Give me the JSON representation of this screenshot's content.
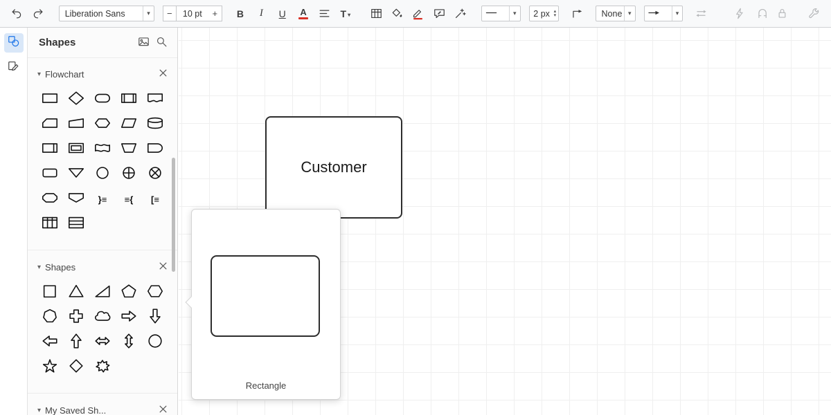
{
  "colors": {
    "accent": "#1a73e8",
    "danger": "#d93025",
    "shape_stroke": "#1a1a1a"
  },
  "toolbar": {
    "icon_undo": "undo-icon",
    "icon_redo": "redo-icon",
    "font_name": "Liberation Sans",
    "size_minus": "−",
    "size_value": "10 pt",
    "size_plus": "+",
    "bold": "B",
    "italic": "I",
    "underline": "U",
    "font_color": "A",
    "icon_align": "align-icon",
    "text_options": "T",
    "icon_table": "table-icon",
    "icon_fill": "fill-color-icon",
    "icon_line_color": "line-color-icon",
    "icon_edit_style": "edit-style-icon",
    "icon_magic_wand": "magic-wand-icon",
    "icon_line_style": "h-line-icon",
    "line_width": "2 px",
    "icon_waypoints": "waypoints-icon",
    "connection": "None",
    "icon_arrow": "arrow-line-icon",
    "icon_swap": "swap-arrows-icon",
    "icon_lightning": "lightning-icon",
    "icon_magnet": "magnet-icon",
    "icon_lock": "lock-icon",
    "icon_wrench": "wrench-icon"
  },
  "rail": {
    "icon_shapes": "shapes-panel-icon",
    "icon_sketch": "sketch-icon"
  },
  "sidebar": {
    "title": "Shapes",
    "icon_image": "image-icon",
    "icon_search": "search-icon",
    "icon_close": "close-icon",
    "sections": [
      {
        "label": "Flowchart",
        "shapes": [
          "process",
          "decision",
          "terminator",
          "predefined-process",
          "document",
          "card",
          "manual-input",
          "preparation",
          "data",
          "database",
          "internal-storage",
          "frame",
          "tape",
          "manual-operation",
          "delay",
          "process-alt",
          "merge",
          "connector",
          "or-junction",
          "summing-junction",
          "loop-limit",
          "off-page-connector",
          "annotation-right",
          "annotation-left",
          "annotation-bracket",
          "column-table",
          "row-table"
        ]
      },
      {
        "label": "Shapes",
        "shapes": [
          "square",
          "triangle",
          "right-triangle",
          "pentagon",
          "hexagon",
          "heptagon",
          "cross",
          "cloud",
          "block-arrow-right",
          "block-arrow-down",
          "block-arrow-left",
          "block-arrow-up",
          "block-arrow-horizontal",
          "block-arrow-vertical",
          "circle",
          "star",
          "diamond",
          "irregular-star"
        ]
      },
      {
        "label": "My Saved Sh...",
        "shapes": []
      }
    ]
  },
  "canvas": {
    "node_label": "Customer"
  },
  "popup": {
    "label": "Rectangle"
  }
}
